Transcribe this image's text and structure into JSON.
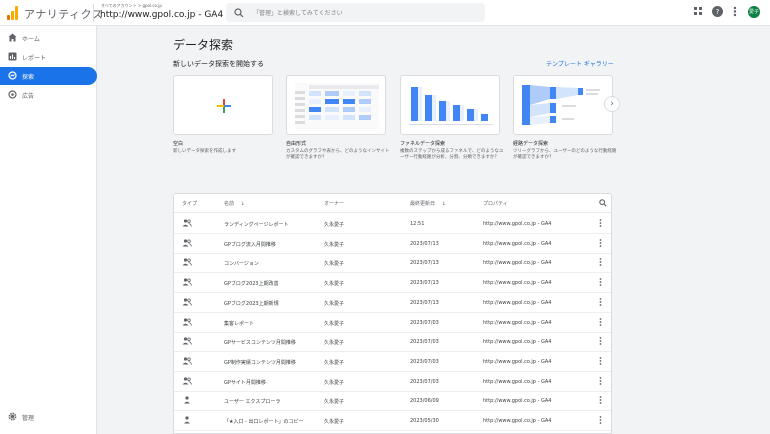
{
  "header": {
    "app_name": "アナリティクス",
    "breadcrumb": "すべてのアカウント > gpol.co.jp",
    "account": "http://www.gpol.co.jp - GA4",
    "account_caret": "▾",
    "search_placeholder": "「管理」と検索してみてください",
    "avatar_text": "愛子",
    "icons": [
      "apps-grid-icon",
      "help-icon",
      "more-vert-icon"
    ]
  },
  "sidebar": {
    "items": [
      {
        "icon": "home-icon",
        "label": "ホーム",
        "active": false
      },
      {
        "icon": "reports-icon",
        "label": "レポート",
        "active": false
      },
      {
        "icon": "explore-icon",
        "label": "探索",
        "active": true
      },
      {
        "icon": "advertising-icon",
        "label": "広告",
        "active": false
      }
    ],
    "admin_label": "管理"
  },
  "main": {
    "title": "データ探索",
    "new_heading": "新しいデータ探索を開始する",
    "gallery_link": "テンプレート ギャラリー",
    "cards": [
      {
        "title": "空白",
        "desc": "新しいデータ探索を作成します"
      },
      {
        "title": "自由形式",
        "desc": "カスタムのグラフや表から、どのようなインサイトが確認できますか？"
      },
      {
        "title": "ファネルデータ探索",
        "desc": "複数のステップから成るファネルで、どのようなユーザー行動経路が分析、分割、分類できますか？"
      },
      {
        "title": "経路データ探索",
        "desc": "ツリーグラフから、ユーザーのどのような行動経路が確認できますか？"
      }
    ],
    "table": {
      "headers": {
        "type": "タイプ",
        "name": "名前",
        "owner": "オーナー",
        "modified": "最終更新日",
        "property": "プロパティ"
      },
      "sort_arrow": "↓",
      "rows": [
        {
          "name": "ランディングページレポート",
          "owner": "久永愛子",
          "date": "12:51",
          "property": "http://www.gpol.co.jp - GA4",
          "shared": true
        },
        {
          "name": "GPブログ流入月間推移",
          "owner": "久永愛子",
          "date": "2023/07/13",
          "property": "http://www.gpol.co.jp - GA4",
          "shared": true
        },
        {
          "name": "コンバージョン",
          "owner": "久永愛子",
          "date": "2023/07/13",
          "property": "http://www.gpol.co.jp - GA4",
          "shared": true
        },
        {
          "name": "GPブログ2023上期改善",
          "owner": "久永愛子",
          "date": "2023/07/13",
          "property": "http://www.gpol.co.jp - GA4",
          "shared": true
        },
        {
          "name": "GPブログ2023上期新規",
          "owner": "久永愛子",
          "date": "2023/07/13",
          "property": "http://www.gpol.co.jp - GA4",
          "shared": true
        },
        {
          "name": "集客レポート",
          "owner": "久永愛子",
          "date": "2023/07/03",
          "property": "http://www.gpol.co.jp - GA4",
          "shared": true
        },
        {
          "name": "GPサービスコンテンツ月間推移",
          "owner": "久永愛子",
          "date": "2023/07/03",
          "property": "http://www.gpol.co.jp - GA4",
          "shared": true
        },
        {
          "name": "GP制作実績コンテンツ月間推移",
          "owner": "久永愛子",
          "date": "2023/07/03",
          "property": "http://www.gpol.co.jp - GA4",
          "shared": true
        },
        {
          "name": "GPサイト月間推移",
          "owner": "久永愛子",
          "date": "2023/07/03",
          "property": "http://www.gpol.co.jp - GA4",
          "shared": true
        },
        {
          "name": "ユーザー エクスプローラ",
          "owner": "久永愛子",
          "date": "2023/06/09",
          "property": "http://www.gpol.co.jp - GA4",
          "shared": false
        },
        {
          "name": "「★入口 - 出口レポート」のコピー",
          "owner": "久永愛子",
          "date": "2023/05/30",
          "property": "http://www.gpol.co.jp - GA4",
          "shared": false
        }
      ]
    }
  },
  "colors": {
    "accent": "#1a73e8",
    "logo_orange": "#f9ab00",
    "logo_dark": "#e37400",
    "avatar": "#0b8043"
  }
}
